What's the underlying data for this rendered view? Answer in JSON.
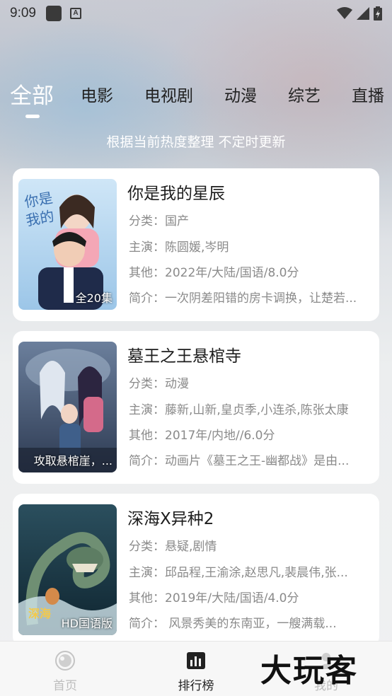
{
  "status_bar": {
    "time": "9:09"
  },
  "tabs": [
    {
      "label": "全部",
      "active": true
    },
    {
      "label": "电影"
    },
    {
      "label": "电视剧"
    },
    {
      "label": "动漫"
    },
    {
      "label": "综艺"
    },
    {
      "label": "直播"
    }
  ],
  "subtitle": "根据当前热度整理 不定时更新",
  "items": [
    {
      "title": "你是我的星辰",
      "badge": "全20集",
      "category_label": "分类：",
      "category": "国产",
      "cast_label": "主演：",
      "cast": "陈圆媛,岑明",
      "other_label": "其他：",
      "other": "2022年/大陆/国语/8.0分",
      "intro_label": "简介：",
      "intro": "一次阴差阳错的房卡调换，让楚若..."
    },
    {
      "title": "墓王之王悬棺寺",
      "badge": "攻取悬棺崖，...",
      "category_label": "分类：",
      "category": "动漫",
      "cast_label": "主演：",
      "cast": "藤新,山新,皇贞季,小连杀,陈张太康",
      "other_label": "其他：",
      "other": "2017年/内地//6.0分",
      "intro_label": "简介：",
      "intro": "动画片《墓王之王-幽都战》是由..."
    },
    {
      "title": "深海X异种2",
      "badge": "HD国语版",
      "category_label": "分类：",
      "category": "悬疑,剧情",
      "cast_label": "主演：",
      "cast": "邱品程,王渝涂,赵思凡,裴晨伟,张...",
      "other_label": "其他：",
      "other": "2019年/大陆/国语/4.0分",
      "intro_label": "简介：",
      "intro": "      风景秀美的东南亚，一艘满载..."
    }
  ],
  "bottom_nav": {
    "home": "首页",
    "rank": "排行榜",
    "mine": "我的"
  },
  "watermark": "大玩客",
  "colors": {
    "active_tab": "#ffffff",
    "text_primary": "#1d1d1d",
    "text_secondary": "#8a8a8a",
    "nav_inactive": "#bdbdbd"
  }
}
